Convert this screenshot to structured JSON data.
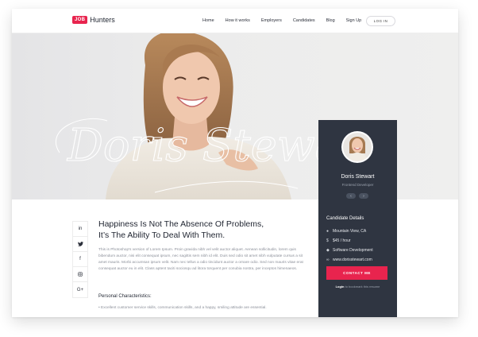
{
  "header": {
    "logo_badge": "JOB",
    "logo_text": "Hunters",
    "nav": [
      "Home",
      "How it works",
      "Employers",
      "Candidates",
      "Blog",
      "Sign Up"
    ],
    "login_label": "LOG IN"
  },
  "hero": {
    "signature_text": "Doris Stewart"
  },
  "card": {
    "name": "Doris Stewart",
    "role": "Frontend Developer",
    "prev_label": "‹",
    "next_label": "›",
    "details_title": "Candidate Details",
    "details": [
      {
        "icon": "location-pin-icon",
        "text": "Mountain View, CA"
      },
      {
        "icon": "dollar-icon",
        "text": "$45 / hour"
      },
      {
        "icon": "tag-icon",
        "text": "Software Development"
      },
      {
        "icon": "link-icon",
        "text": "www.dorisstewart.com"
      }
    ],
    "contact_label": "CONTACT ME",
    "footer_strong": "Login",
    "footer_text": "to bookmark this resume"
  },
  "social": [
    {
      "icon": "linkedin-icon",
      "glyph": "in"
    },
    {
      "icon": "twitter-icon",
      "glyph": "🐦"
    },
    {
      "icon": "facebook-icon",
      "glyph": "f"
    },
    {
      "icon": "instagram-icon",
      "glyph": "◎"
    },
    {
      "icon": "google-plus-icon",
      "glyph": "G+"
    }
  ],
  "content": {
    "headline_line1": "Happiness Is Not The Absence Of Problems,",
    "headline_line2": "It’s The Ability To Deal With Them.",
    "paragraph": "This is Photoshop's version  of Lorem Ipsum. Proin gravida nibh vel velit auctor aliquet. Aenean sollicitu­din, lorem quis bibendum auctor, nisi elit consequat ipsum, nec sagittis sem nibh id elit. Duis sed odio sit amet nibh vulputate cursus a sit amet mauris. Morbi accumsan ipsum velit. Nam nec tellus a odio tincid­unt auctor a ornare odio. Sed non  mauris vitae erat consequat auctor eu in elit. Class aptent taciti so­ciosqu ad litora torquent per conubia nostra, per inceptos himenaeos.",
    "characteristics_title": "Personal Characteristics:",
    "characteristics_item": "Excellent customer service skills, communication skills, and a happy, smiling attitude are essential."
  },
  "colors": {
    "accent": "#e8244e",
    "card_bg": "#2f3541"
  }
}
